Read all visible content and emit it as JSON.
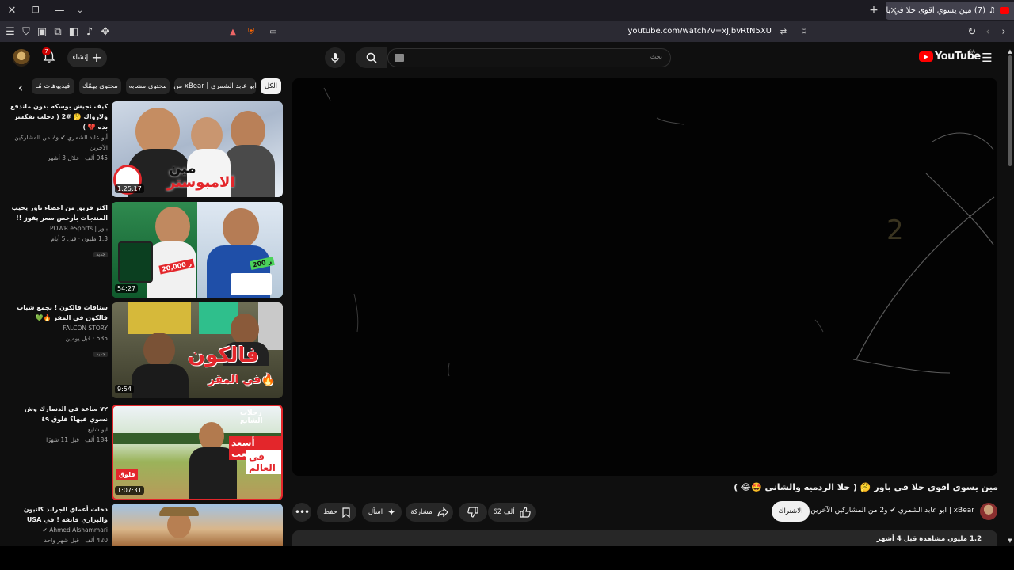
{
  "browser": {
    "tab_title": "(7) مين يسوي اقوى حلا في باور !",
    "url": "youtube.com/watch?v=xJjbvRtN5XU"
  },
  "header": {
    "logo_text": "YouTube",
    "region": "SA",
    "search_placeholder": "بحث",
    "create_label": "إنشاء",
    "notifications_count": "7"
  },
  "chips": [
    "الكل",
    "من xBear | ابو عابد الشمري",
    "محتوى مشابه",
    "محتوى يهمّك",
    "فيديوهات مُـ"
  ],
  "related": [
    {
      "title": "كيف نجيش بوسكه بدون ماندفع ولازواك 🤔 #2 ( دخلت تفكسر بده 💔 )",
      "channel": "أبو عابد الشمري ✔ و2 من المشاركين الآخرين",
      "meta": "945 ألف  · خلال 3 أشهر",
      "duration": "1:25:17",
      "badge": ""
    },
    {
      "title": "اكثر فريق من اعضاء باور يجيب المنتجات بأرخص سعر يفوز !!",
      "channel": "باور | POWR eSports",
      "meta": "1.3 مليون  · قبل 5 أيام",
      "duration": "54:27",
      "badge": "جديد"
    },
    {
      "title": "سنافات فالكون ! نجمع شباب فالكون في المقر 🔥💚",
      "channel": "FALCON STORY",
      "meta": "535  · قبل يومين",
      "duration": "9:54",
      "badge": "جديد"
    },
    {
      "title": "٧٢ ساعة في الدنمارك وش نسوي فيها؟ فلوق ٤٩",
      "channel": "ابو شايع",
      "meta": "184 ألف  · قبل 11 شهرًا",
      "duration": "1:07:31",
      "badge": ""
    },
    {
      "title": "دخلت أعماق الجراند كانيون والبراري فاتقة ! في USA",
      "channel": "Ahmed Alshammari ✔",
      "meta": "420 ألف  · قبل شهر واحد",
      "duration": "",
      "badge": ""
    }
  ],
  "video": {
    "title": "مين يسوي اقوى حلا في باور 🤔 ( حلا الردميه والشاني 🤩😂 )",
    "channel": "xBear | ابو عابد الشمري ✔ و2 من المشاركين الآخرين",
    "subscribe_label": "الاشتراك",
    "likes": "62 ألف",
    "share_label": "مشاركة",
    "ask_label": "اسأل",
    "save_label": "حفظ",
    "views_meta": "1.2 مليون مشاهدة قبل 4 أشهر"
  }
}
